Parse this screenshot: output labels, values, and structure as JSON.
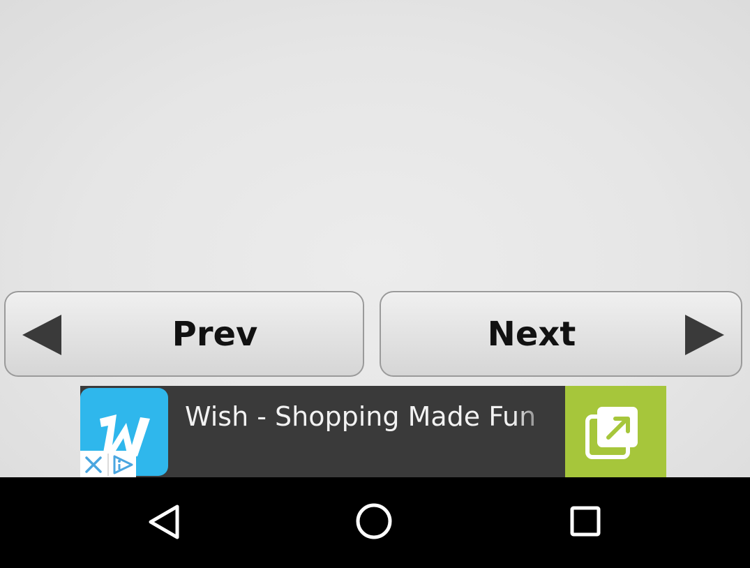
{
  "navigation": {
    "prev_label": "Prev",
    "next_label": "Next"
  },
  "ad": {
    "title": "Wish - Shopping Made Fun",
    "logo_icon": "wish-logo-icon",
    "open_icon": "external-link-icon",
    "close_icon": "close-icon",
    "adchoices_icon": "adchoices-icon",
    "colors": {
      "logo_bg": "#2fb7ec",
      "banner_bg": "#3a3a3a",
      "open_bg": "#a6c63b"
    }
  },
  "system_nav": {
    "back_icon": "back-triangle-icon",
    "home_icon": "home-circle-icon",
    "recents_icon": "recents-square-icon"
  }
}
